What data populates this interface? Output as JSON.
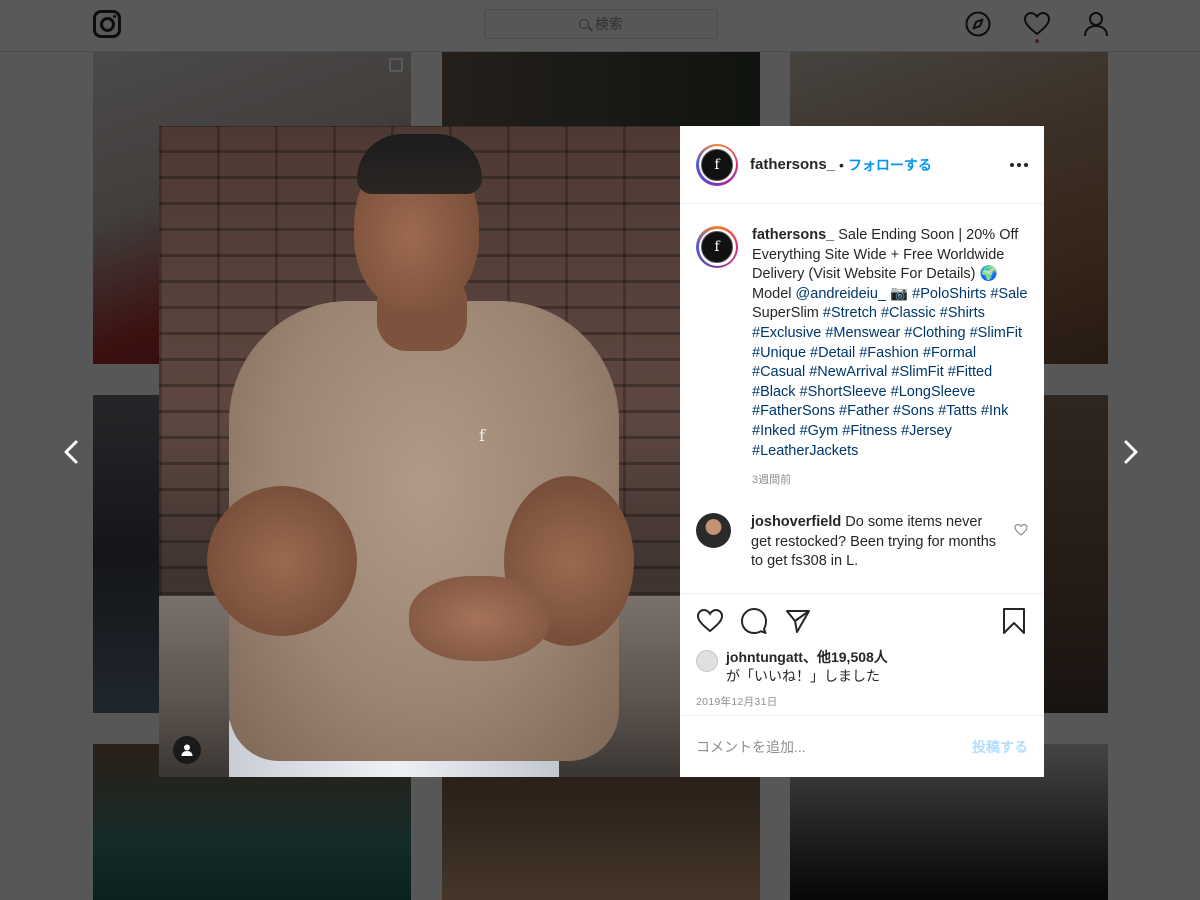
{
  "topbar": {
    "logo_icon": "instagram-icon",
    "search_placeholder": "検索",
    "nav_icons": [
      "compass-icon",
      "heart-icon",
      "profile-icon"
    ],
    "notification_color": "#ed4956"
  },
  "modal": {
    "photo_icon": "user-tag-icon",
    "author": {
      "username": "fathersons_",
      "separator": "•",
      "follow_label": "フォローする",
      "avatar_letter": "f"
    },
    "caption": {
      "username": "fathersons_",
      "text": "Sale Ending Soon | 20% Off Everything Site Wide + Free Worldwide Delivery (Visit Website For Details) 🌍 Model",
      "mention": "@andreideiu_",
      "camera": "📷",
      "hashtag_lead": "#PoloShirts #Sale",
      "plain_word": "SuperSlim",
      "hashtags": "#Stretch #Classic #Shirts #Exclusive #Menswear #Clothing #SlimFit #Unique #Detail #Fashion #Formal #Casual #NewArrival #SlimFit #Fitted #Black #ShortSleeve #LongSleeve #FatherSons #Father #Sons #Tatts #Ink #Inked #Gym #Fitness #Jersey #LeatherJackets",
      "time_ago": "3週間前"
    },
    "comment": {
      "username": "joshoverfield",
      "text": "Do some items never get restocked? Been trying for months to get fs308 in L."
    },
    "likes": {
      "username": "johntungatt",
      "count_text": "、他19,508人",
      "suffix": "が「いいね！」しました"
    },
    "post_date": "2019年12月31日",
    "add_comment_placeholder": "コメントを追加...",
    "post_button": "投稿する",
    "link_color": "#00376b",
    "accent_color": "#0095f6"
  }
}
